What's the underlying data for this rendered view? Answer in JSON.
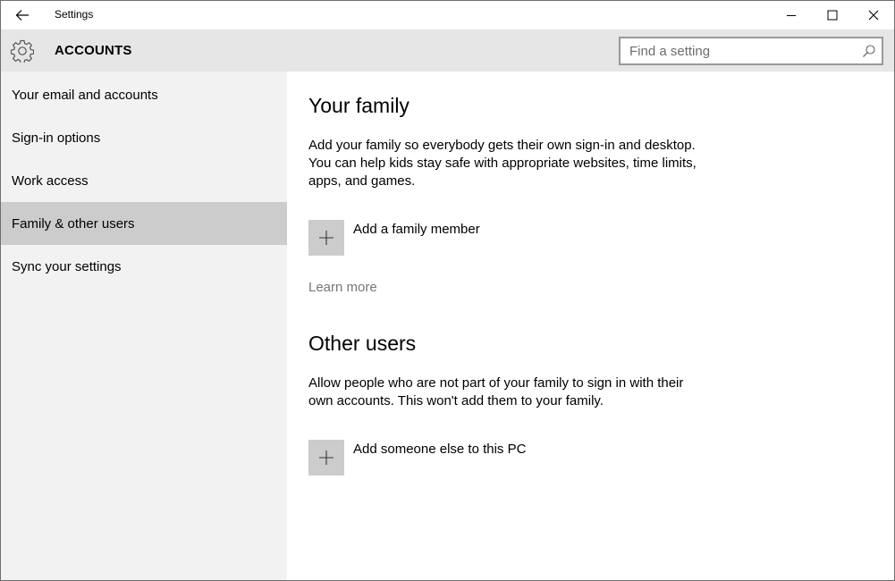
{
  "window": {
    "title": "Settings",
    "back_icon": "back-arrow-icon",
    "minimize_icon": "minimize-icon",
    "maximize_icon": "maximize-icon",
    "close_icon": "close-icon"
  },
  "header": {
    "icon": "gear-icon",
    "title": "ACCOUNTS",
    "search": {
      "placeholder": "Find a setting",
      "value": "",
      "icon": "search-icon"
    }
  },
  "sidebar": {
    "items": [
      {
        "label": "Your email and accounts",
        "selected": false
      },
      {
        "label": "Sign-in options",
        "selected": false
      },
      {
        "label": "Work access",
        "selected": false
      },
      {
        "label": "Family & other users",
        "selected": true
      },
      {
        "label": "Sync your settings",
        "selected": false
      }
    ]
  },
  "main": {
    "family": {
      "title": "Your family",
      "description": "Add your family so everybody gets their own sign-in and desktop. You can help kids stay safe with appropriate websites, time limits, apps, and games.",
      "add_label": "Add a family member",
      "add_icon": "plus-icon",
      "learn_more": "Learn more"
    },
    "other": {
      "title": "Other users",
      "description": "Allow people who are not part of your family to sign in with their own accounts. This won't add them to your family.",
      "add_label": "Add someone else to this PC",
      "add_icon": "plus-icon"
    }
  },
  "colors": {
    "header_bg": "#e6e6e6",
    "sidebar_bg": "#f2f2f2",
    "selected_bg": "#cccccc",
    "link": "#767676"
  }
}
